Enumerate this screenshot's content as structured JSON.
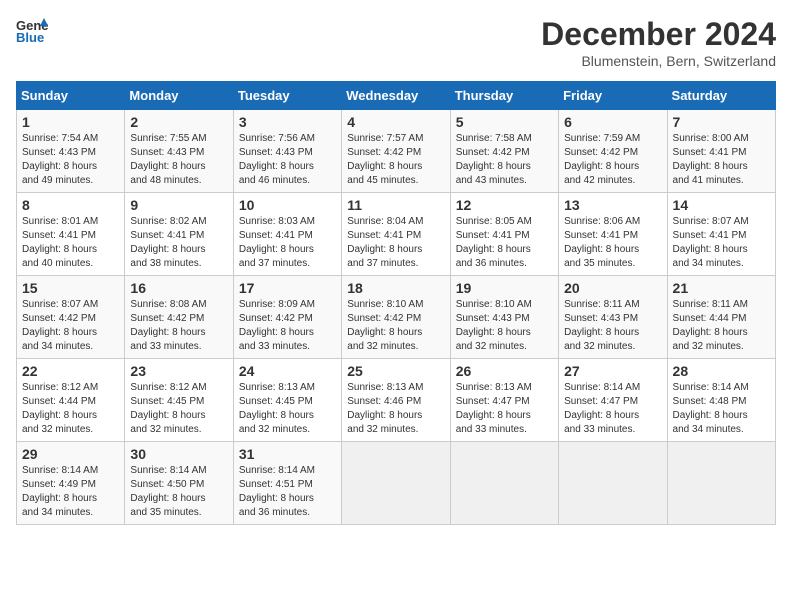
{
  "header": {
    "logo_line1": "General",
    "logo_line2": "Blue",
    "month_title": "December 2024",
    "location": "Blumenstein, Bern, Switzerland"
  },
  "weekdays": [
    "Sunday",
    "Monday",
    "Tuesday",
    "Wednesday",
    "Thursday",
    "Friday",
    "Saturday"
  ],
  "weeks": [
    [
      {
        "day": "1",
        "info": "Sunrise: 7:54 AM\nSunset: 4:43 PM\nDaylight: 8 hours\nand 49 minutes."
      },
      {
        "day": "2",
        "info": "Sunrise: 7:55 AM\nSunset: 4:43 PM\nDaylight: 8 hours\nand 48 minutes."
      },
      {
        "day": "3",
        "info": "Sunrise: 7:56 AM\nSunset: 4:43 PM\nDaylight: 8 hours\nand 46 minutes."
      },
      {
        "day": "4",
        "info": "Sunrise: 7:57 AM\nSunset: 4:42 PM\nDaylight: 8 hours\nand 45 minutes."
      },
      {
        "day": "5",
        "info": "Sunrise: 7:58 AM\nSunset: 4:42 PM\nDaylight: 8 hours\nand 43 minutes."
      },
      {
        "day": "6",
        "info": "Sunrise: 7:59 AM\nSunset: 4:42 PM\nDaylight: 8 hours\nand 42 minutes."
      },
      {
        "day": "7",
        "info": "Sunrise: 8:00 AM\nSunset: 4:41 PM\nDaylight: 8 hours\nand 41 minutes."
      }
    ],
    [
      {
        "day": "8",
        "info": "Sunrise: 8:01 AM\nSunset: 4:41 PM\nDaylight: 8 hours\nand 40 minutes."
      },
      {
        "day": "9",
        "info": "Sunrise: 8:02 AM\nSunset: 4:41 PM\nDaylight: 8 hours\nand 38 minutes."
      },
      {
        "day": "10",
        "info": "Sunrise: 8:03 AM\nSunset: 4:41 PM\nDaylight: 8 hours\nand 37 minutes."
      },
      {
        "day": "11",
        "info": "Sunrise: 8:04 AM\nSunset: 4:41 PM\nDaylight: 8 hours\nand 37 minutes."
      },
      {
        "day": "12",
        "info": "Sunrise: 8:05 AM\nSunset: 4:41 PM\nDaylight: 8 hours\nand 36 minutes."
      },
      {
        "day": "13",
        "info": "Sunrise: 8:06 AM\nSunset: 4:41 PM\nDaylight: 8 hours\nand 35 minutes."
      },
      {
        "day": "14",
        "info": "Sunrise: 8:07 AM\nSunset: 4:41 PM\nDaylight: 8 hours\nand 34 minutes."
      }
    ],
    [
      {
        "day": "15",
        "info": "Sunrise: 8:07 AM\nSunset: 4:42 PM\nDaylight: 8 hours\nand 34 minutes."
      },
      {
        "day": "16",
        "info": "Sunrise: 8:08 AM\nSunset: 4:42 PM\nDaylight: 8 hours\nand 33 minutes."
      },
      {
        "day": "17",
        "info": "Sunrise: 8:09 AM\nSunset: 4:42 PM\nDaylight: 8 hours\nand 33 minutes."
      },
      {
        "day": "18",
        "info": "Sunrise: 8:10 AM\nSunset: 4:42 PM\nDaylight: 8 hours\nand 32 minutes."
      },
      {
        "day": "19",
        "info": "Sunrise: 8:10 AM\nSunset: 4:43 PM\nDaylight: 8 hours\nand 32 minutes."
      },
      {
        "day": "20",
        "info": "Sunrise: 8:11 AM\nSunset: 4:43 PM\nDaylight: 8 hours\nand 32 minutes."
      },
      {
        "day": "21",
        "info": "Sunrise: 8:11 AM\nSunset: 4:44 PM\nDaylight: 8 hours\nand 32 minutes."
      }
    ],
    [
      {
        "day": "22",
        "info": "Sunrise: 8:12 AM\nSunset: 4:44 PM\nDaylight: 8 hours\nand 32 minutes."
      },
      {
        "day": "23",
        "info": "Sunrise: 8:12 AM\nSunset: 4:45 PM\nDaylight: 8 hours\nand 32 minutes."
      },
      {
        "day": "24",
        "info": "Sunrise: 8:13 AM\nSunset: 4:45 PM\nDaylight: 8 hours\nand 32 minutes."
      },
      {
        "day": "25",
        "info": "Sunrise: 8:13 AM\nSunset: 4:46 PM\nDaylight: 8 hours\nand 32 minutes."
      },
      {
        "day": "26",
        "info": "Sunrise: 8:13 AM\nSunset: 4:47 PM\nDaylight: 8 hours\nand 33 minutes."
      },
      {
        "day": "27",
        "info": "Sunrise: 8:14 AM\nSunset: 4:47 PM\nDaylight: 8 hours\nand 33 minutes."
      },
      {
        "day": "28",
        "info": "Sunrise: 8:14 AM\nSunset: 4:48 PM\nDaylight: 8 hours\nand 34 minutes."
      }
    ],
    [
      {
        "day": "29",
        "info": "Sunrise: 8:14 AM\nSunset: 4:49 PM\nDaylight: 8 hours\nand 34 minutes."
      },
      {
        "day": "30",
        "info": "Sunrise: 8:14 AM\nSunset: 4:50 PM\nDaylight: 8 hours\nand 35 minutes."
      },
      {
        "day": "31",
        "info": "Sunrise: 8:14 AM\nSunset: 4:51 PM\nDaylight: 8 hours\nand 36 minutes."
      },
      null,
      null,
      null,
      null
    ]
  ]
}
